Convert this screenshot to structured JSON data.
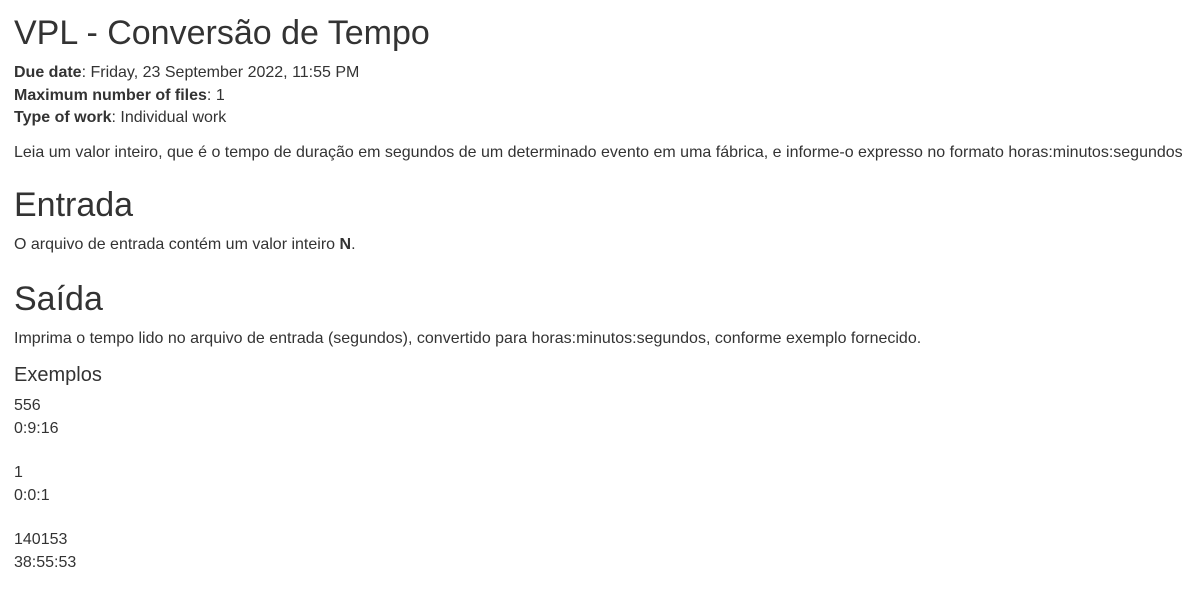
{
  "title": "VPL - Conversão de Tempo",
  "meta": {
    "due_date_label": "Due date",
    "due_date_value": ": Friday, 23 September 2022, 11:55 PM",
    "max_files_label": "Maximum number of files",
    "max_files_value": ": 1",
    "work_type_label": "Type of work",
    "work_type_value": ": Individual work"
  },
  "description": "Leia um valor inteiro, que é o tempo de duração em segundos de um determinado evento em uma fábrica, e informe-o expresso no formato horas:minutos:segundos.",
  "entrada": {
    "heading": "Entrada",
    "text_before": "O arquivo de entrada contém um valor inteiro ",
    "text_bold": "N",
    "text_after": "."
  },
  "saida": {
    "heading": "Saída",
    "text": "Imprima o tempo lido no arquivo de entrada (segundos), convertido para horas:minutos:segundos, conforme exemplo fornecido."
  },
  "exemplos": {
    "heading": "Exemplos",
    "items": [
      {
        "input": "556",
        "output": "0:9:16"
      },
      {
        "input": "1",
        "output": "0:0:1"
      },
      {
        "input": "140153",
        "output": "38:55:53"
      }
    ]
  }
}
